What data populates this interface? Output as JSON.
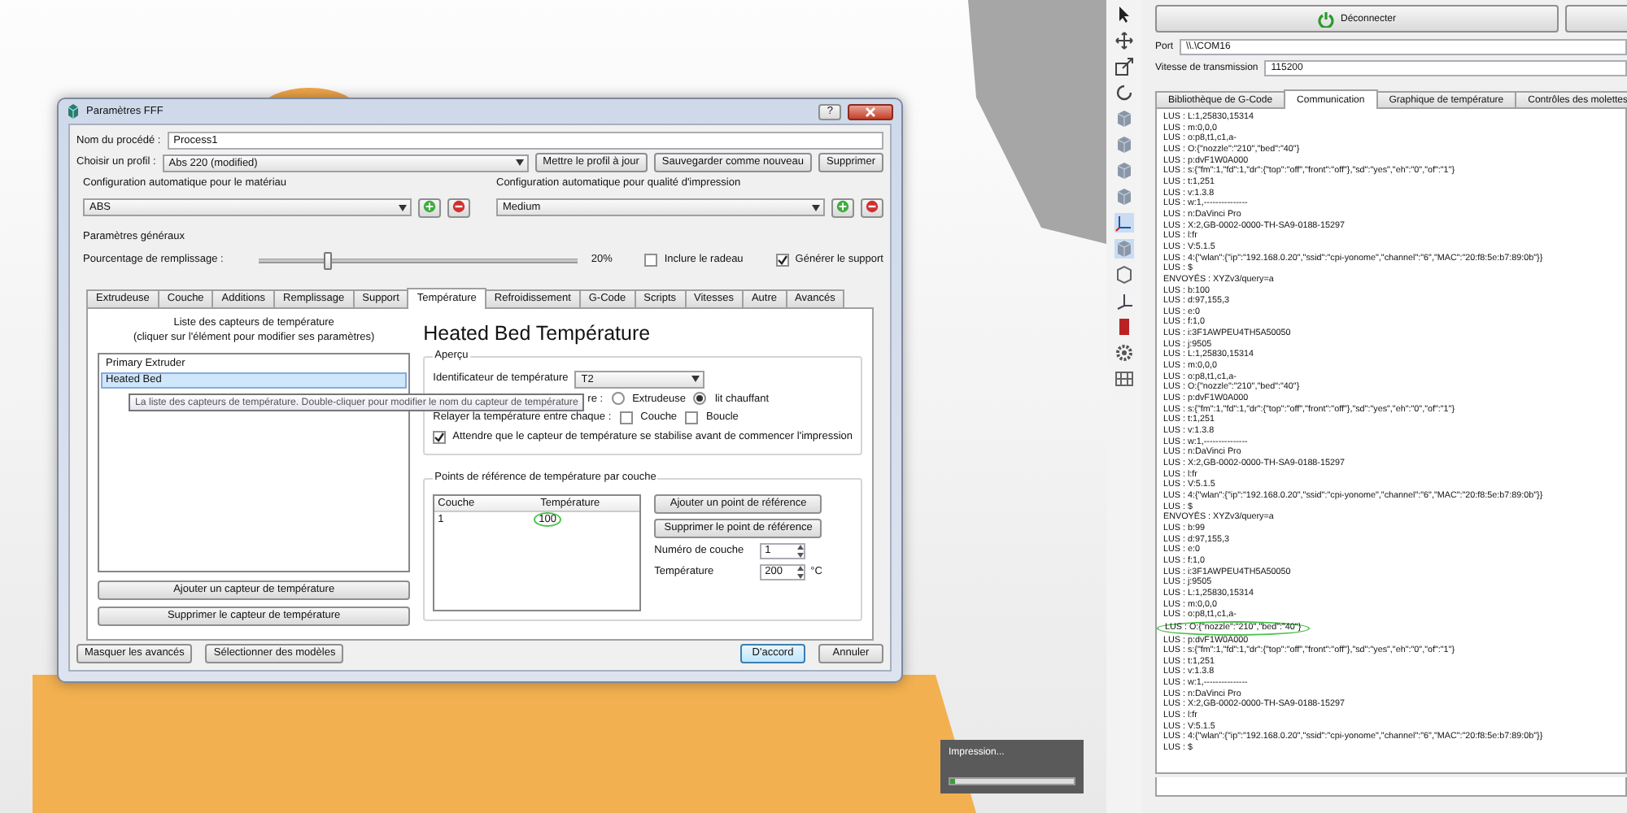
{
  "viewport": {
    "progress": {
      "label": "Impression...",
      "level": 0.04
    }
  },
  "dialog": {
    "title": "Paramètres FFF",
    "help": "?",
    "process_name": {
      "label": "Nom du procédé :",
      "value": "Process1"
    },
    "profile": {
      "label": "Choisir un profil :",
      "value": "Abs 220 (modified)"
    },
    "profile_buttons": [
      "Mettre le profil à jour",
      "Sauvegarder comme nouveau",
      "Supprimer"
    ],
    "auto_configs": [
      {
        "label": "Configuration automatique pour le matériau",
        "value": "ABS"
      },
      {
        "label": "Configuration automatique pour qualité d'impression",
        "value": "Medium"
      }
    ],
    "general": {
      "title": "Paramètres généraux",
      "infill_label": "Pourcentage de remplissage :",
      "level": 0.2,
      "infill_value": "20%",
      "options": [
        {
          "label": "Inclure le radeau",
          "checked": false
        },
        {
          "label": "Générer le support",
          "checked": true
        }
      ]
    },
    "tabs": [
      {
        "label": "Extrudeuse",
        "selected": false
      },
      {
        "label": "Couche",
        "selected": false
      },
      {
        "label": "Additions",
        "selected": false
      },
      {
        "label": "Remplissage",
        "selected": false
      },
      {
        "label": "Support",
        "selected": false
      },
      {
        "label": "Température",
        "selected": true
      },
      {
        "label": "Refroidissement",
        "selected": false
      },
      {
        "label": "G-Code",
        "selected": false
      },
      {
        "label": "Scripts",
        "selected": false
      },
      {
        "label": "Vitesses",
        "selected": false
      },
      {
        "label": "Autre",
        "selected": false
      },
      {
        "label": "Avancés",
        "selected": false
      }
    ],
    "sensors": {
      "header_lines": [
        "Liste des capteurs de température",
        "(cliquer sur l'élément pour modifier ses paramètres)"
      ],
      "items": [
        {
          "label": "Primary Extruder",
          "selected": false
        },
        {
          "label": "Heated Bed",
          "selected": true
        }
      ],
      "buttons": [
        "Ajouter un capteur de température",
        "Supprimer le capteur de température"
      ],
      "tooltip": "La liste des capteurs de température. Double-cliquer pour modifier le nom du capteur de température"
    },
    "detail": {
      "title": "Heated Bed Température",
      "overview": {
        "legend": "Aperçu",
        "identifier": {
          "label": "Identificateur de température",
          "value": "T2"
        },
        "type": {
          "label": "re :",
          "options": [
            {
              "label": "Extrudeuse",
              "selected": false
            },
            {
              "label": "lit chauffant",
              "selected": true
            }
          ]
        },
        "relay": {
          "label": "Relayer la température entre chaque :",
          "options": [
            {
              "label": "Couche",
              "checked": false
            },
            {
              "label": "Boucle",
              "checked": false
            }
          ]
        },
        "wait": {
          "label": "Attendre que le capteur de température se stabilise avant de commencer l'impression",
          "checked": true
        }
      },
      "setpoints": {
        "legend": "Points de référence de température par couche",
        "columns": [
          "Couche",
          "Température"
        ],
        "rows": [
          {
            "layer": "1",
            "temperature": "100",
            "circled": true
          }
        ],
        "buttons": [
          "Ajouter un point de référence",
          "Supprimer le point de référence"
        ],
        "layer": {
          "label": "Numéro de couche",
          "value": "1"
        },
        "temperature": {
          "label": "Température",
          "value": "200",
          "unit": "°C"
        }
      }
    },
    "footer_left": [
      "Masquer les avancés",
      "Sélectionner des modèles"
    ],
    "footer_right": [
      {
        "label": "D'accord",
        "default": true
      },
      {
        "label": "Annuler",
        "default": false
      }
    ]
  },
  "printer": {
    "connect_button": "Déconnecter",
    "port": {
      "label": "Port",
      "value": "\\\\.\\COM16"
    },
    "baud": {
      "label": "Vitesse de transmission",
      "value": "115200"
    },
    "tabs": [
      {
        "label": "Bibliothèque de G-Code",
        "selected": false
      },
      {
        "label": "Communication",
        "selected": true
      },
      {
        "label": "Graphique de température",
        "selected": false
      },
      {
        "label": "Contrôles des molettes",
        "selected": false
      }
    ],
    "log": [
      {
        "text": "LUS : L:1,25830,15314",
        "circled": false
      },
      {
        "text": "LUS : m:0,0,0",
        "circled": false
      },
      {
        "text": "LUS : o:p8,t1,c1,a-",
        "circled": false
      },
      {
        "text": "LUS : O:{\"nozzle\":\"210\",\"bed\":\"40\"}",
        "circled": false
      },
      {
        "text": "LUS : p:dvF1W0A000",
        "circled": false
      },
      {
        "text": "LUS : s:{\"fm\":1,\"fd\":1,\"dr\":{\"top\":\"off\",\"front\":\"off\"},\"sd\":\"yes\",\"eh\":\"0\",\"of\":\"1\"}",
        "circled": false
      },
      {
        "text": "LUS : t:1,251",
        "circled": false
      },
      {
        "text": "LUS : v:1.3.8",
        "circled": false
      },
      {
        "text": "LUS : w:1,---------------",
        "circled": false
      },
      {
        "text": "LUS : n:DaVinci Pro",
        "circled": false
      },
      {
        "text": "LUS : X:2,GB-0002-0000-TH-SA9-0188-15297",
        "circled": false
      },
      {
        "text": "LUS : l:fr",
        "circled": false
      },
      {
        "text": "LUS : V:5.1.5",
        "circled": false
      },
      {
        "text": "LUS : 4:{\"wlan\":{\"ip\":\"192.168.0.20\",\"ssid\":\"cpi-yonome\",\"channel\":\"6\",\"MAC\":\"20:f8:5e:b7:89:0b\"}}",
        "circled": false
      },
      {
        "text": "LUS : $",
        "circled": false
      },
      {
        "text": "ENVOYÉS : XYZv3/query=a",
        "circled": false
      },
      {
        "text": "LUS : b:100",
        "circled": false
      },
      {
        "text": "LUS : d:97,155,3",
        "circled": false
      },
      {
        "text": "LUS : e:0",
        "circled": false
      },
      {
        "text": "LUS : f:1,0",
        "circled": false
      },
      {
        "text": "LUS : i:3F1AWPEU4TH5A50050",
        "circled": false
      },
      {
        "text": "LUS : j:9505",
        "circled": false
      },
      {
        "text": "LUS : L:1,25830,15314",
        "circled": false
      },
      {
        "text": "LUS : m:0,0,0",
        "circled": false
      },
      {
        "text": "LUS : o:p8,t1,c1,a-",
        "circled": false
      },
      {
        "text": "LUS : O:{\"nozzle\":\"210\",\"bed\":\"40\"}",
        "circled": false
      },
      {
        "text": "LUS : p:dvF1W0A000",
        "circled": false
      },
      {
        "text": "LUS : s:{\"fm\":1,\"fd\":1,\"dr\":{\"top\":\"off\",\"front\":\"off\"},\"sd\":\"yes\",\"eh\":\"0\",\"of\":\"1\"}",
        "circled": false
      },
      {
        "text": "LUS : t:1,251",
        "circled": false
      },
      {
        "text": "LUS : v:1.3.8",
        "circled": false
      },
      {
        "text": "LUS : w:1,---------------",
        "circled": false
      },
      {
        "text": "LUS : n:DaVinci Pro",
        "circled": false
      },
      {
        "text": "LUS : X:2,GB-0002-0000-TH-SA9-0188-15297",
        "circled": false
      },
      {
        "text": "LUS : l:fr",
        "circled": false
      },
      {
        "text": "LUS : V:5.1.5",
        "circled": false
      },
      {
        "text": "LUS : 4:{\"wlan\":{\"ip\":\"192.168.0.20\",\"ssid\":\"cpi-yonome\",\"channel\":\"6\",\"MAC\":\"20:f8:5e:b7:89:0b\"}}",
        "circled": false
      },
      {
        "text": "LUS : $",
        "circled": false
      },
      {
        "text": "ENVOYÉS : XYZv3/query=a",
        "circled": false
      },
      {
        "text": "LUS : b:99",
        "circled": false
      },
      {
        "text": "LUS : d:97,155,3",
        "circled": false
      },
      {
        "text": "LUS : e:0",
        "circled": false
      },
      {
        "text": "LUS : f:1,0",
        "circled": false
      },
      {
        "text": "LUS : i:3F1AWPEU4TH5A50050",
        "circled": false
      },
      {
        "text": "LUS : j:9505",
        "circled": false
      },
      {
        "text": "LUS : L:1,25830,15314",
        "circled": false
      },
      {
        "text": "LUS : m:0,0,0",
        "circled": false
      },
      {
        "text": "LUS : o:p8,t1,c1,a-",
        "circled": false
      },
      {
        "text": "LUS : O:{\"nozzle\":\"210\",\"bed\":\"40\"}",
        "circled": true
      },
      {
        "text": "LUS : p:dvF1W0A000",
        "circled": false
      },
      {
        "text": "LUS : s:{\"fm\":1,\"fd\":1,\"dr\":{\"top\":\"off\",\"front\":\"off\"},\"sd\":\"yes\",\"eh\":\"0\",\"of\":\"1\"}",
        "circled": false
      },
      {
        "text": "LUS : t:1,251",
        "circled": false
      },
      {
        "text": "LUS : v:1.3.8",
        "circled": false
      },
      {
        "text": "LUS : w:1,---------------",
        "circled": false
      },
      {
        "text": "LUS : n:DaVinci Pro",
        "circled": false
      },
      {
        "text": "LUS : X:2,GB-0002-0000-TH-SA9-0188-15297",
        "circled": false
      },
      {
        "text": "LUS : l:fr",
        "circled": false
      },
      {
        "text": "LUS : V:5.1.5",
        "circled": false
      },
      {
        "text": "LUS : 4:{\"wlan\":{\"ip\":\"192.168.0.20\",\"ssid\":\"cpi-yonome\",\"channel\":\"6\",\"MAC\":\"20:f8:5e:b7:89:0b\"}}",
        "circled": false
      },
      {
        "text": "LUS : $",
        "circled": false
      }
    ]
  }
}
